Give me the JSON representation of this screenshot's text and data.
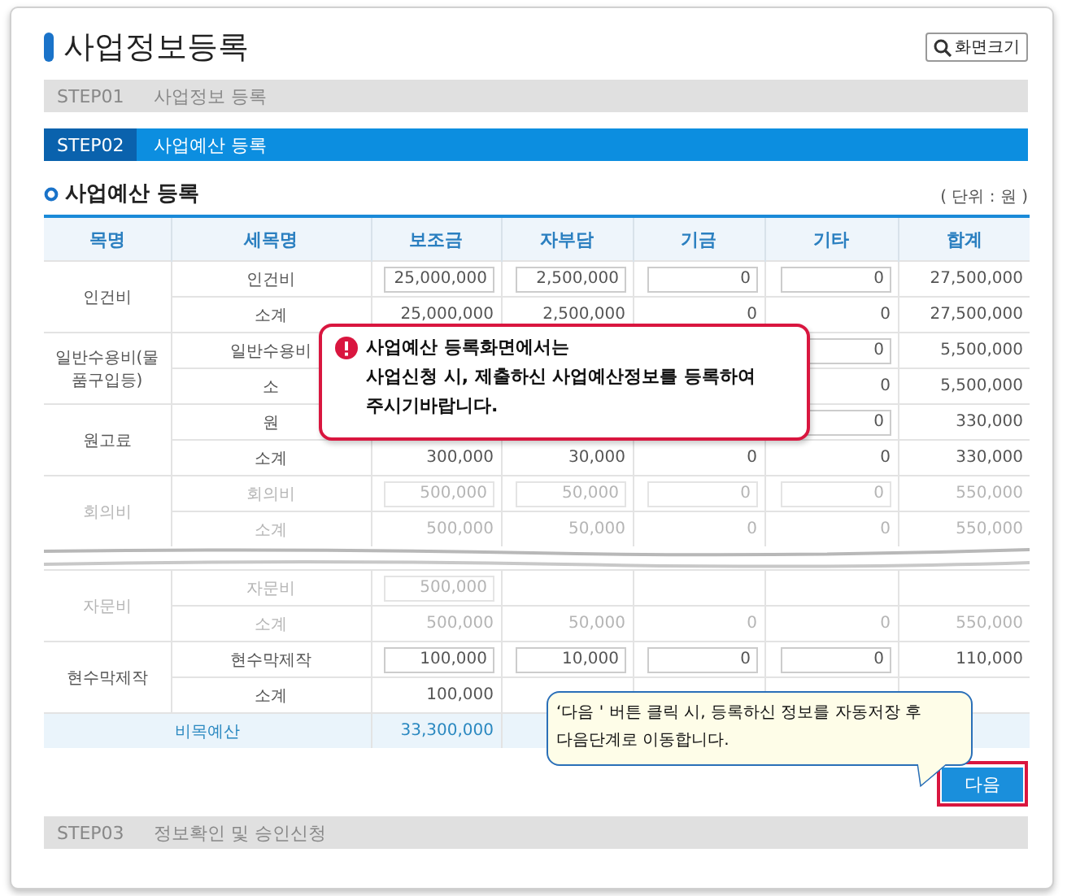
{
  "page": {
    "title": "사업정보등록",
    "zoom_button": "화면크기"
  },
  "steps_before": [
    {
      "number": "STEP01",
      "label": "사업정보 등록",
      "selected": false
    },
    {
      "number": "STEP02",
      "label": "사업예산 등록",
      "selected": true
    }
  ],
  "section": {
    "title": "사업예산 등록",
    "unit": "( 단위 : 원 )"
  },
  "table": {
    "columns": [
      "목명",
      "세목명",
      "보조금",
      "자부담",
      "기금",
      "기타",
      "합계"
    ],
    "upper_groups": [
      {
        "item": "인건비",
        "faded": false,
        "rows": [
          {
            "kind": "input",
            "sub": "인건비",
            "values": {
              "subsidy": "25,000,000",
              "self_pay": "2,500,000",
              "fund": "0",
              "other": "0",
              "total": "27,500,000"
            }
          },
          {
            "kind": "subtotal",
            "sub": "소계",
            "values": {
              "subsidy": "25,000,000",
              "self_pay": "2,500,000",
              "fund": "0",
              "other": "0",
              "total": "27,500,000"
            }
          }
        ]
      },
      {
        "item": "일반수용비(물품구입등)",
        "faded": false,
        "rows": [
          {
            "kind": "input",
            "sub": "일반수용비",
            "values": {
              "other": "0",
              "total": "5,500,000"
            }
          },
          {
            "kind": "subtotal",
            "sub": "소",
            "values": {
              "other": "0",
              "total": "5,500,000"
            }
          }
        ]
      },
      {
        "item": "원고료",
        "faded": false,
        "rows": [
          {
            "kind": "input",
            "sub": "원",
            "values": {
              "other": "0",
              "total": "330,000"
            }
          },
          {
            "kind": "subtotal",
            "sub": "소계",
            "values": {
              "subsidy": "300,000",
              "self_pay": "30,000",
              "fund": "0",
              "other": "0",
              "total": "330,000"
            }
          }
        ]
      },
      {
        "item": "회의비",
        "faded": true,
        "rows": [
          {
            "kind": "input",
            "sub": "회의비",
            "values": {
              "subsidy": "500,000",
              "self_pay": "50,000",
              "fund": "0",
              "other": "0",
              "total": "550,000"
            }
          },
          {
            "kind": "subtotal",
            "sub": "소계",
            "values": {
              "subsidy": "500,000",
              "self_pay": "50,000",
              "fund": "0",
              "other": "0",
              "total": "550,000"
            }
          }
        ]
      }
    ],
    "lower_groups": [
      {
        "item": "자문비",
        "faded": true,
        "rows": [
          {
            "kind": "input",
            "sub": "자문비",
            "values": {
              "subsidy": "500,000"
            }
          },
          {
            "kind": "subtotal",
            "sub": "소계",
            "values": {
              "subsidy": "500,000",
              "self_pay": "50,000",
              "fund": "0",
              "other": "0",
              "total": "550,000"
            }
          }
        ]
      },
      {
        "item": "현수막제작",
        "faded": false,
        "rows": [
          {
            "kind": "input",
            "sub": "현수막제작",
            "values": {
              "subsidy": "100,000",
              "self_pay": "10,000",
              "fund": "0",
              "other": "0",
              "total": "110,000"
            }
          },
          {
            "kind": "subtotal",
            "sub": "소계",
            "values": {
              "subsidy": "100,000"
            }
          }
        ]
      }
    ],
    "total": {
      "label": "비목예산",
      "values": {
        "subsidy": "33,300,000"
      }
    }
  },
  "callouts": [
    {
      "kind": "alert",
      "text": "사업예산 등록화면에서는\n사업신청 시, 제출하신 사업예산정보를 등록하여\n주시기바랍니다."
    },
    {
      "kind": "hint",
      "text": "‘다음 ' 버튼 클릭 시, 등록하신 정보를 자동저장 후\n다음단계로 이동합니다."
    }
  ],
  "next_button": {
    "label": "다음",
    "highlighted": true
  },
  "steps_after": [
    {
      "number": "STEP03",
      "label": "정보확인 및 승인신청",
      "selected": false
    }
  ]
}
